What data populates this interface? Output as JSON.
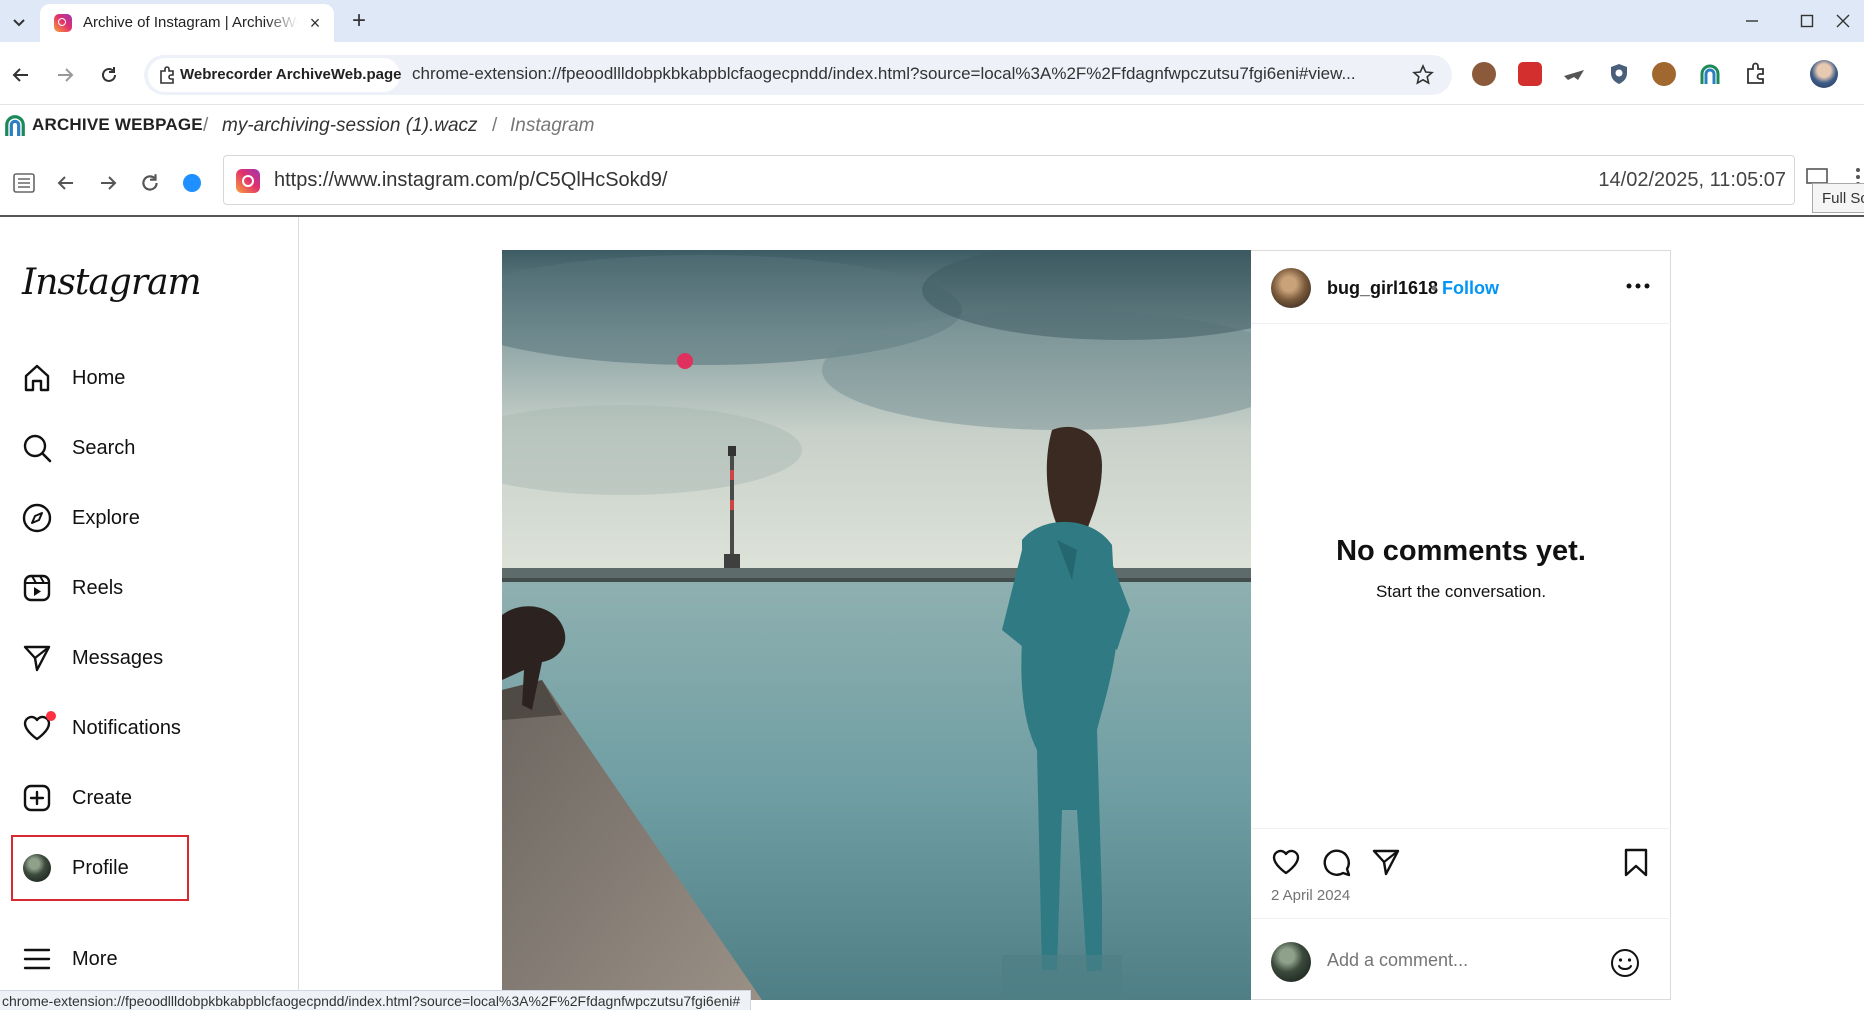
{
  "browser": {
    "tab_title": "Archive of Instagram | ArchiveWeb.page",
    "tab_close": "×",
    "new_tab": "+",
    "site_chip": "Webrecorder ArchiveWeb.page",
    "url": "chrome-extension://fpeoodllldobpkbkabpblcfaogecpndd/index.html?source=local%3A%2F%2Ffdagnfwpczutsu7fgi6eni#view...",
    "status_url": "chrome-extension://fpeoodllldobpkbkabpblcfaogecpndd/index.html?source=local%3A%2F%2Ffdagnfwpczutsu7fgi6eni#"
  },
  "archive": {
    "logo_text": "ARCHIVE WEBPAGE",
    "breadcrumbs": [
      "my-archiving-session (1).wacz",
      "Instagram"
    ],
    "separator": "/",
    "replay_url": "https://www.instagram.com/p/C5QlHcSokd9/",
    "timestamp": "14/02/2025, 11:05:07",
    "tooltip": "Full Sc"
  },
  "instagram": {
    "logo": "Instagram",
    "nav": [
      {
        "label": "Home",
        "icon": "home-icon"
      },
      {
        "label": "Search",
        "icon": "search-icon"
      },
      {
        "label": "Explore",
        "icon": "explore-icon"
      },
      {
        "label": "Reels",
        "icon": "reels-icon"
      },
      {
        "label": "Messages",
        "icon": "messages-icon"
      },
      {
        "label": "Notifications",
        "icon": "heart-icon"
      },
      {
        "label": "Create",
        "icon": "create-icon"
      },
      {
        "label": "Profile",
        "icon": "avatar"
      },
      {
        "label": "More",
        "icon": "menu-icon"
      }
    ],
    "post": {
      "username": "bug_girl1618",
      "dot": "•",
      "follow": "Follow",
      "no_comments_title": "No comments yet.",
      "no_comments_sub": "Start the conversation.",
      "date": "2 April 2024",
      "comment_placeholder": "Add a comment..."
    }
  },
  "colors": {
    "instagram_blue": "#0095f6",
    "highlight_red": "#d9282f",
    "notification_dot": "#ff3040"
  }
}
